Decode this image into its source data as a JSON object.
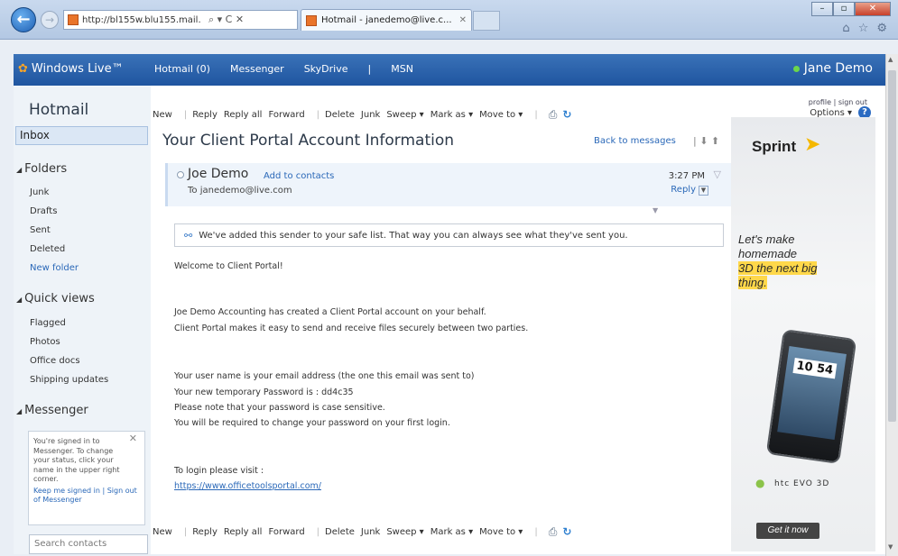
{
  "browser": {
    "url": "http://bl155w.blu155.mail.",
    "address_controls": "⌕ ▾ C ✕",
    "tab_title": "Hotmail - janedemo@live.c...",
    "tab_close": "✕",
    "back": "←",
    "forward": "→",
    "window_buttons": [
      "–",
      "▫",
      "✕"
    ],
    "tool_icons": [
      "⌂",
      "☆",
      "⚙"
    ]
  },
  "live_bar": {
    "logo_text": "Windows Live™",
    "nav": [
      "Hotmail (0)",
      "Messenger",
      "SkyDrive",
      "|",
      "MSN"
    ],
    "user_name": "Jane Demo",
    "profile_links": "profile | sign out"
  },
  "sidebar": {
    "brand": "Hotmail",
    "inbox": "Inbox",
    "folders_head": "Folders",
    "folders": [
      "Junk",
      "Drafts",
      "Sent",
      "Deleted"
    ],
    "new_folder": "New folder",
    "quick_views_head": "Quick views",
    "quick_views": [
      "Flagged",
      "Photos",
      "Office docs",
      "Shipping updates"
    ],
    "messenger_head": "Messenger",
    "messenger_box_text": "You're signed in to Messenger. To change your status, click your name in the upper right corner.",
    "messenger_links": "Keep me signed in | Sign out of Messenger",
    "search_contacts": "Search contacts"
  },
  "toolbar": {
    "items": [
      "New",
      "|",
      "Reply",
      "Reply all",
      "Forward",
      "|",
      "Delete",
      "Junk",
      "Sweep ▾",
      "Mark as ▾",
      "Move to ▾",
      "|"
    ],
    "options": "Options ▾",
    "help": "?"
  },
  "message": {
    "subject": "Your Client Portal Account Information",
    "back_to_messages": "Back to messages",
    "nav_arrows": "|  ⬇  ⬆",
    "sender": "Joe Demo",
    "add_to_contacts": "Add to contacts",
    "to": "To janedemo@live.com",
    "time": "3:27 PM",
    "reply": "Reply",
    "safe_notice": "We've added this sender to your safe list. That way you can always see what they've sent you.",
    "body": {
      "greeting": "Welcome to Client Portal!",
      "p1a": "Joe Demo Accounting has created a Client Portal account on your behalf.",
      "p1b": "Client Portal makes it easy to send and receive files securely between two parties.",
      "p2a": "Your user name is your email address (the one this email was sent to)",
      "p2b": "Your new temporary Password is : dd4c35",
      "p2c": "Please note that your password is case sensitive.",
      "p2d": "You will be required to change your password on your first login.",
      "p3a": "To login please visit :",
      "link": "https://www.officetoolsportal.com/"
    }
  },
  "ad": {
    "brand": "Sprint",
    "line1": "Let's make",
    "line2": "homemade",
    "line3": "3D the next big",
    "line4": "thing.",
    "clock": "10 54",
    "phone_brand": "htc EVO 3D",
    "cta": "Get it now"
  },
  "colors": {
    "live_bar": "#1f55a0",
    "link": "#2a68b8",
    "highlight": "#ffd84a"
  }
}
